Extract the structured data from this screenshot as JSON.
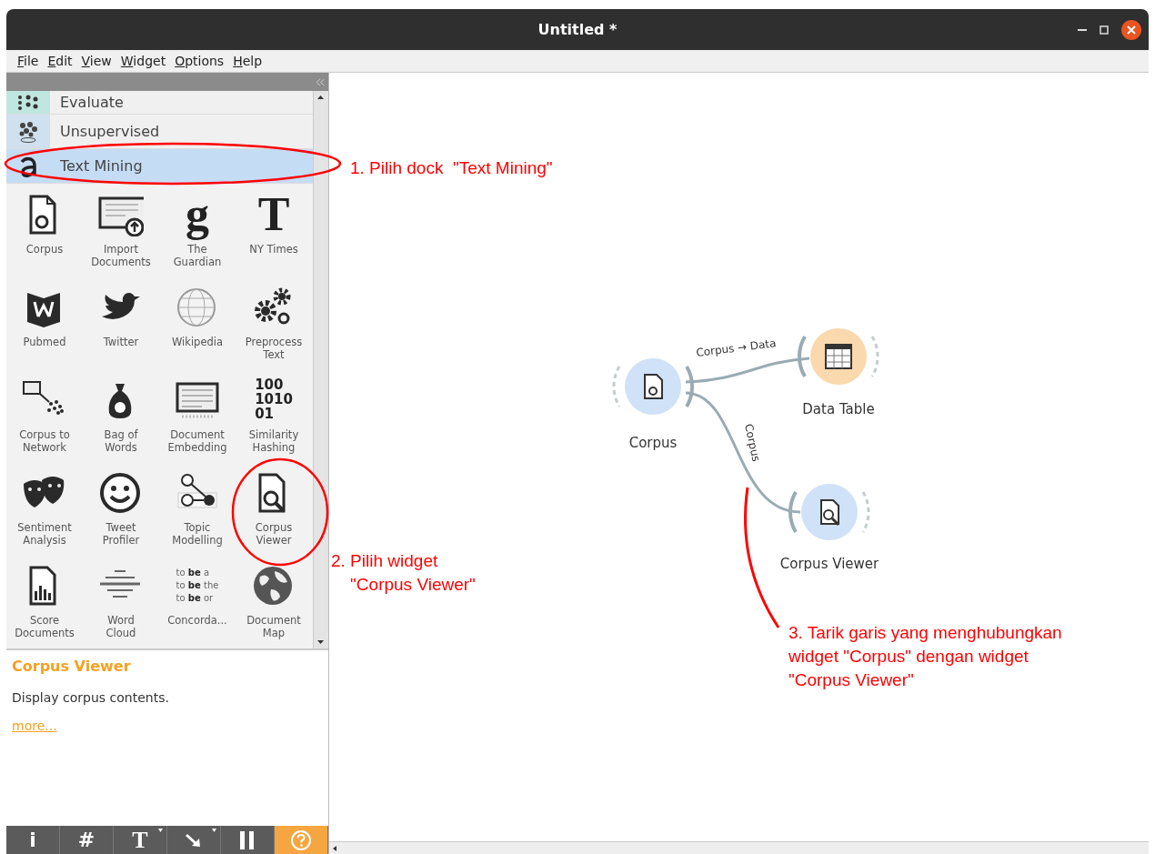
{
  "window": {
    "title": "Untitled *"
  },
  "menu": [
    "File",
    "Edit",
    "View",
    "Widget",
    "Options",
    "Help"
  ],
  "categories": [
    {
      "label": "Evaluate",
      "selected": false,
      "color": "#bfe6df"
    },
    {
      "label": "Unsupervised",
      "selected": false,
      "color": "#cfe0ee"
    },
    {
      "label": "Text Mining",
      "selected": true,
      "color": "#c5dcf5"
    }
  ],
  "widgets": [
    {
      "label": "Corpus"
    },
    {
      "label": "Import\nDocuments"
    },
    {
      "label": "The\nGuardian",
      "glyph": [
        "g"
      ]
    },
    {
      "label": "NY Times",
      "glyph": [
        "T"
      ]
    },
    {
      "label": "Pubmed"
    },
    {
      "label": "Twitter"
    },
    {
      "label": "Wikipedia"
    },
    {
      "label": "Preprocess\nText"
    },
    {
      "label": "Corpus to\nNetwork"
    },
    {
      "label": "Bag of\nWords"
    },
    {
      "label": "Document\nEmbedding"
    },
    {
      "label": "Similarity\nHashing",
      "glyph": [
        "100",
        "1010",
        "01"
      ]
    },
    {
      "label": "Sentiment\nAnalysis"
    },
    {
      "label": "Tweet\nProfiler"
    },
    {
      "label": "Topic\nModelling"
    },
    {
      "label": "Corpus\nViewer"
    },
    {
      "label": "Score\nDocuments"
    },
    {
      "label": "Word\nCloud"
    },
    {
      "label": "Concorda...",
      "glyph": [
        "to **be** a",
        "to **be** the",
        "to **be** or"
      ]
    },
    {
      "label": "Document\nMap"
    }
  ],
  "description": {
    "title": "Corpus Viewer",
    "text": "Display corpus contents.",
    "link": "more..."
  },
  "toolbar": [
    {
      "label": "i",
      "selected": false
    },
    {
      "label": "#",
      "selected": false
    },
    {
      "label": "T",
      "selected": false,
      "dropdown": true
    },
    {
      "kind": "arrow",
      "selected": false,
      "dropdown": true
    },
    {
      "kind": "pause",
      "selected": false
    },
    {
      "kind": "help",
      "selected": true
    }
  ],
  "canvas": {
    "nodes": [
      {
        "label": "Corpus",
        "color": "#cfe2f7"
      },
      {
        "label": "Data Table",
        "color": "#f9d9ad"
      },
      {
        "label": "Corpus Viewer",
        "color": "#cfe2f7"
      }
    ],
    "links": [
      {
        "label": "Corpus → Data"
      },
      {
        "label": "Corpus"
      }
    ]
  },
  "annotations": [
    {
      "kind": "ellipse"
    },
    {
      "kind": "ellipse"
    },
    {
      "kind": "line"
    }
  ],
  "notes": [
    {
      "text": "1. Pilih dock  \"Text Mining\""
    },
    {
      "text": "2. Pilih widget\n    \"Corpus Viewer\""
    },
    {
      "text": "3. Tarik garis yang menghubungkan\nwidget \"Corpus\" dengan widget\n\"Corpus Viewer\""
    }
  ]
}
